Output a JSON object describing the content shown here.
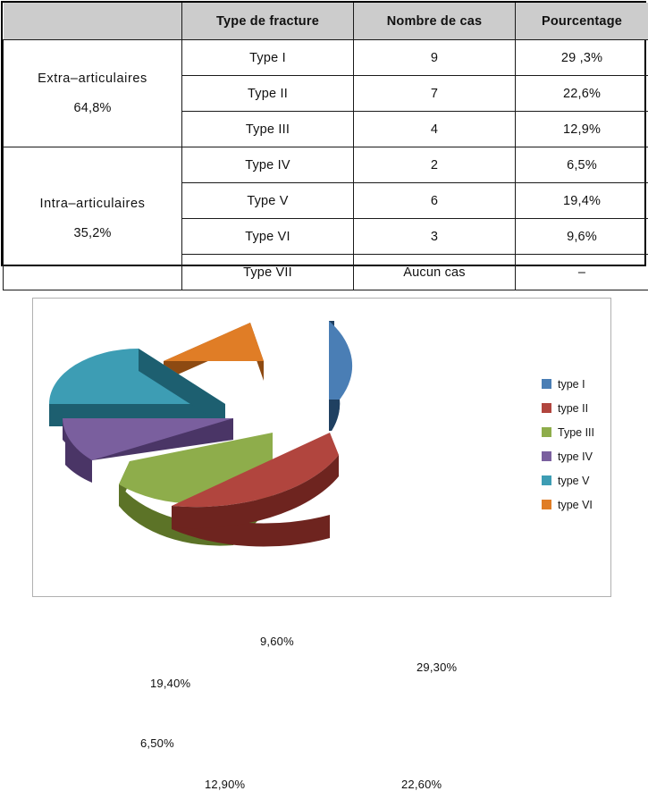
{
  "table": {
    "columns": [
      "",
      "Type de fracture",
      "Nombre  de cas",
      "Pourcentage"
    ],
    "groups": [
      {
        "name": "Extra–articulaires",
        "percent": "64,8%",
        "rows": [
          {
            "type": "Type I",
            "cases": "9",
            "percent": "29 ,3%"
          },
          {
            "type": "Type II",
            "cases": "7",
            "percent": "22,6%"
          },
          {
            "type": "Type III",
            "cases": "4",
            "percent": "12,9%"
          }
        ]
      },
      {
        "name": "Intra–articulaires",
        "percent": "35,2%",
        "rows": [
          {
            "type": "Type IV",
            "cases": "2",
            "percent": "6,5%"
          },
          {
            "type": "Type V",
            "cases": "6",
            "percent": "19,4%"
          },
          {
            "type": "Type VI",
            "cases": "3",
            "percent": "9,6%"
          },
          {
            "type": "Type VII",
            "cases": "Aucun cas",
            "percent": "–"
          }
        ]
      }
    ]
  },
  "chart_data": {
    "type": "pie",
    "title": "",
    "exploded": true,
    "three_d": true,
    "legend_position": "right",
    "categories": [
      "type I",
      "type II",
      "Type III",
      "type IV",
      "type V",
      "type VI"
    ],
    "values": [
      29.3,
      22.6,
      12.9,
      6.5,
      19.4,
      9.6
    ],
    "data_labels": [
      "29,30%",
      "22,60%",
      "12,90%",
      "6,50%",
      "19,40%",
      "9,60%"
    ],
    "colors": [
      "#4a7eb5",
      "#b1453e",
      "#8ead4b",
      "#7a5f9e",
      "#3d9db4",
      "#e07d26"
    ],
    "side_colors": [
      "#1f4061",
      "#6e241f",
      "#5c7327",
      "#4a3566",
      "#1d5f70",
      "#8d4a12"
    ],
    "legend": [
      {
        "label": "type I",
        "color": "#4a7eb5"
      },
      {
        "label": "type II",
        "color": "#b1453e"
      },
      {
        "label": "Type III",
        "color": "#8ead4b"
      },
      {
        "label": "type IV",
        "color": "#7a5f9e"
      },
      {
        "label": "type V",
        "color": "#3d9db4"
      },
      {
        "label": "type VI",
        "color": "#e07d26"
      }
    ]
  }
}
